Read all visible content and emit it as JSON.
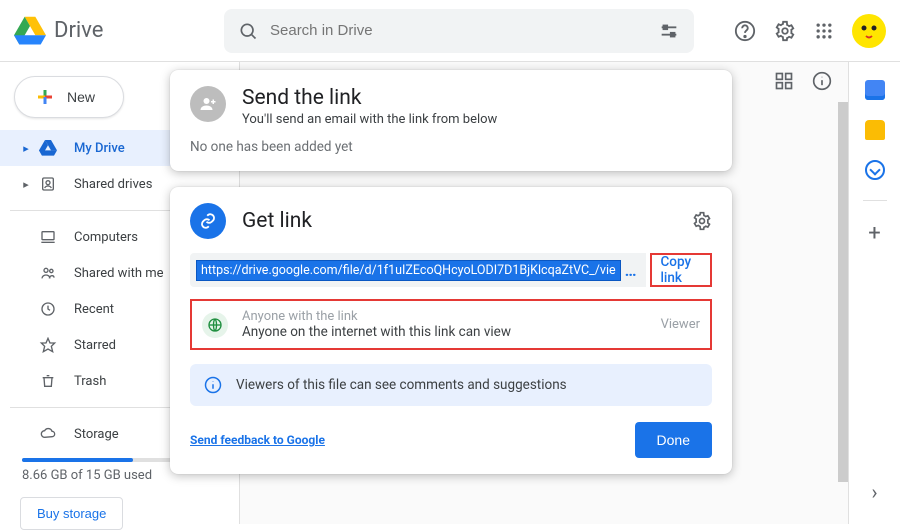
{
  "header": {
    "app_name": "Drive",
    "search_placeholder": "Search in Drive"
  },
  "sidebar": {
    "new_label": "New",
    "items": [
      {
        "label": "My Drive",
        "expandable": true
      },
      {
        "label": "Shared drives",
        "expandable": true
      },
      {
        "label": "Computers",
        "expandable": false
      },
      {
        "label": "Shared with me",
        "expandable": false
      },
      {
        "label": "Recent",
        "expandable": false
      },
      {
        "label": "Starred",
        "expandable": false
      },
      {
        "label": "Trash",
        "expandable": false
      },
      {
        "label": "Storage",
        "expandable": false
      }
    ],
    "storage_text": "8.66 GB of 15 GB used",
    "buy_storage_label": "Buy storage"
  },
  "share": {
    "send_title": "Send the link",
    "send_subtitle": "You'll send an email with the link from below",
    "not_added": "No one has been added yet",
    "getlink_title": "Get link",
    "url": "https://drive.google.com/file/d/1f1uIZEcoQHcyoLODI7D1BjKlcqaZtVC_/vie",
    "copy_label": "Copy link",
    "scope_label": "Anyone with the link",
    "scope_desc": "Anyone on the internet with this link can view",
    "role": "Viewer",
    "info": "Viewers of this file can see comments and suggestions",
    "feedback": "Send feedback to Google",
    "done": "Done"
  }
}
